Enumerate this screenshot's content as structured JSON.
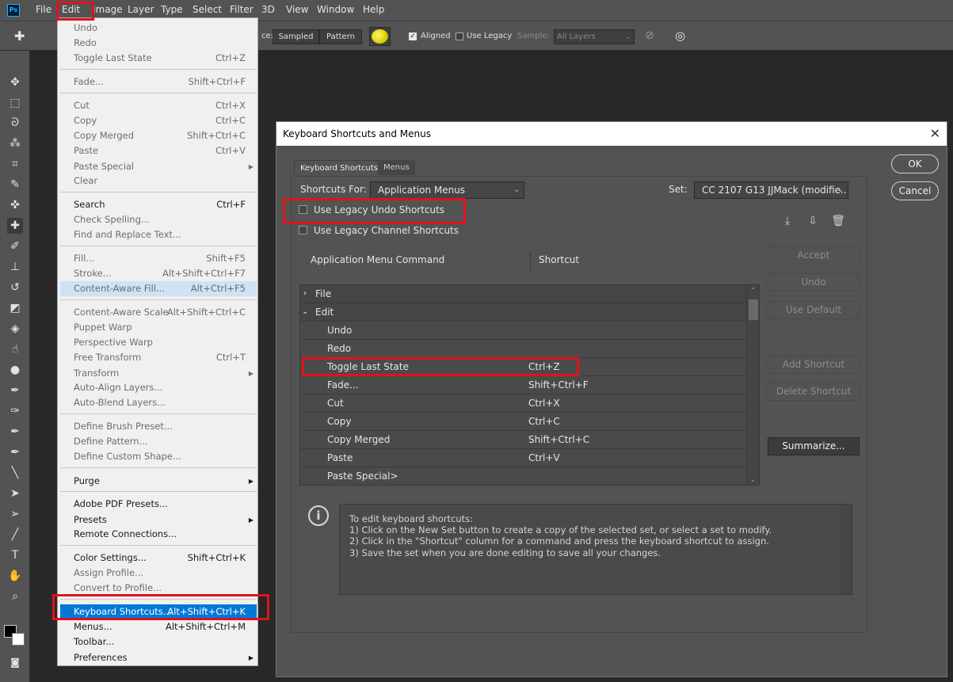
{
  "app": {
    "logo_text": "Ps"
  },
  "menubar": {
    "items": [
      "File",
      "Edit",
      "Image",
      "Layer",
      "Type",
      "Select",
      "Filter",
      "3D",
      "View",
      "Window",
      "Help"
    ]
  },
  "options_bar": {
    "source_label": "ce:",
    "sampled_label": "Sampled",
    "pattern_label": "Pattern",
    "aligned_label": "Aligned",
    "aligned_checked": true,
    "use_legacy_label": "Use Legacy",
    "use_legacy_checked": false,
    "sample_label": "Sample:",
    "sample_value": "All Layers"
  },
  "tools": [
    "move-tool-icon",
    "marquee-tool-icon",
    "lasso-tool-icon",
    "magic-wand-tool-icon",
    "crop-tool-icon",
    "eyedropper-tool-icon",
    "spot-healing-tool-icon",
    "healing-brush-tool-icon",
    "brush-tool-icon",
    "clone-stamp-tool-icon",
    "history-brush-tool-icon",
    "eraser-tool-icon",
    "paint-bucket-tool-icon",
    "smudge-tool-icon",
    "dodge-tool-icon",
    "pen-tool-icon",
    "freeform-pen-tool-icon",
    "add-anchor-tool-icon",
    "convert-point-tool-icon",
    "path-selection-tool-icon",
    "direct-selection-tool-icon",
    "line-tool-icon",
    "type-tool-icon",
    "hand-tool-icon",
    "zoom-tool-icon"
  ],
  "edit_menu": {
    "items": [
      {
        "label": "Undo",
        "shortcut": "",
        "disabled": true
      },
      {
        "label": "Redo",
        "shortcut": "",
        "disabled": true
      },
      {
        "label": "Toggle Last State",
        "shortcut": "Ctrl+Z",
        "disabled": true
      },
      {
        "label": "Fade...",
        "shortcut": "Shift+Ctrl+F",
        "disabled": true
      },
      {
        "label": "Cut",
        "shortcut": "Ctrl+X",
        "disabled": true
      },
      {
        "label": "Copy",
        "shortcut": "Ctrl+C",
        "disabled": true
      },
      {
        "label": "Copy Merged",
        "shortcut": "Shift+Ctrl+C",
        "disabled": true
      },
      {
        "label": "Paste",
        "shortcut": "Ctrl+V",
        "disabled": true
      },
      {
        "label": "Paste Special",
        "shortcut": "",
        "disabled": true,
        "submenu": true
      },
      {
        "label": "Clear",
        "shortcut": "",
        "disabled": true
      },
      {
        "label": "Search",
        "shortcut": "Ctrl+F",
        "disabled": false
      },
      {
        "label": "Check Spelling...",
        "shortcut": "",
        "disabled": true
      },
      {
        "label": "Find and Replace Text...",
        "shortcut": "",
        "disabled": true
      },
      {
        "label": "Fill...",
        "shortcut": "Shift+F5",
        "disabled": true
      },
      {
        "label": "Stroke...",
        "shortcut": "Alt+Shift+Ctrl+F7",
        "disabled": true
      },
      {
        "label": "Content-Aware Fill...",
        "shortcut": "Alt+Ctrl+F5",
        "disabled": true,
        "highlight": true
      },
      {
        "label": "Content-Aware Scale",
        "shortcut": "Alt+Shift+Ctrl+C",
        "disabled": true
      },
      {
        "label": "Puppet Warp",
        "shortcut": "",
        "disabled": true
      },
      {
        "label": "Perspective Warp",
        "shortcut": "",
        "disabled": true
      },
      {
        "label": "Free Transform",
        "shortcut": "Ctrl+T",
        "disabled": true
      },
      {
        "label": "Transform",
        "shortcut": "",
        "disabled": true,
        "submenu": true
      },
      {
        "label": "Auto-Align Layers...",
        "shortcut": "",
        "disabled": true
      },
      {
        "label": "Auto-Blend Layers...",
        "shortcut": "",
        "disabled": true
      },
      {
        "label": "Define Brush Preset...",
        "shortcut": "",
        "disabled": true
      },
      {
        "label": "Define Pattern...",
        "shortcut": "",
        "disabled": true
      },
      {
        "label": "Define Custom Shape...",
        "shortcut": "",
        "disabled": true
      },
      {
        "label": "Purge",
        "shortcut": "",
        "disabled": false,
        "submenu": true
      },
      {
        "label": "Adobe PDF Presets...",
        "shortcut": "",
        "disabled": false
      },
      {
        "label": "Presets",
        "shortcut": "",
        "disabled": false,
        "submenu": true
      },
      {
        "label": "Remote Connections...",
        "shortcut": "",
        "disabled": false
      },
      {
        "label": "Color Settings...",
        "shortcut": "Shift+Ctrl+K",
        "disabled": false
      },
      {
        "label": "Assign Profile...",
        "shortcut": "",
        "disabled": true
      },
      {
        "label": "Convert to Profile...",
        "shortcut": "",
        "disabled": true
      },
      {
        "label": "Keyboard Shortcuts...",
        "shortcut": "Alt+Shift+Ctrl+K",
        "disabled": false,
        "selected": true
      },
      {
        "label": "Menus...",
        "shortcut": "Alt+Shift+Ctrl+M",
        "disabled": false
      },
      {
        "label": "Toolbar...",
        "shortcut": "",
        "disabled": false
      },
      {
        "label": "Preferences",
        "shortcut": "",
        "disabled": false,
        "submenu": true
      }
    ]
  },
  "dialog": {
    "title": "Keyboard Shortcuts and Menus",
    "tabs": [
      "Keyboard Shortcuts",
      "Menus"
    ],
    "shortcuts_for_label": "Shortcuts For:",
    "shortcuts_for_value": "Application Menus",
    "set_label": "Set:",
    "set_value": "CC 2107 G13 JJMack (modifie...",
    "legacy_undo_label": "Use Legacy Undo Shortcuts",
    "legacy_channel_label": "Use Legacy Channel Shortcuts",
    "col_command": "Application Menu Command",
    "col_shortcut": "Shortcut",
    "rows": [
      {
        "command": "File",
        "shortcut": "",
        "group": true,
        "expanded": false
      },
      {
        "command": "Edit",
        "shortcut": "",
        "group": true,
        "expanded": true
      },
      {
        "command": "Undo",
        "shortcut": ""
      },
      {
        "command": "Redo",
        "shortcut": ""
      },
      {
        "command": "Toggle Last State",
        "shortcut": "Ctrl+Z"
      },
      {
        "command": "Fade...",
        "shortcut": "Shift+Ctrl+F"
      },
      {
        "command": "Cut",
        "shortcut": "Ctrl+X"
      },
      {
        "command": "Copy",
        "shortcut": "Ctrl+C"
      },
      {
        "command": "Copy Merged",
        "shortcut": "Shift+Ctrl+C"
      },
      {
        "command": "Paste",
        "shortcut": "Ctrl+V"
      },
      {
        "command": "Paste Special>",
        "shortcut": ""
      }
    ],
    "buttons": {
      "ok": "OK",
      "cancel": "Cancel",
      "accept": "Accept",
      "undo": "Undo",
      "use_default": "Use Default",
      "add_shortcut": "Add Shortcut",
      "delete_shortcut": "Delete Shortcut",
      "summarize": "Summarize..."
    },
    "info": {
      "lines": [
        "To edit keyboard shortcuts:",
        "1) Click on the New Set button to create a copy of the selected set, or select a set to modify.",
        "2) Click in the \"Shortcut\" column for a command and press the keyboard shortcut to assign.",
        "3) Save the set when you are done editing to save all your changes."
      ]
    }
  },
  "colors": {
    "highlight_red": "#e0121b",
    "menu_selected": "#0078d7",
    "ui_gray": "#535353"
  }
}
